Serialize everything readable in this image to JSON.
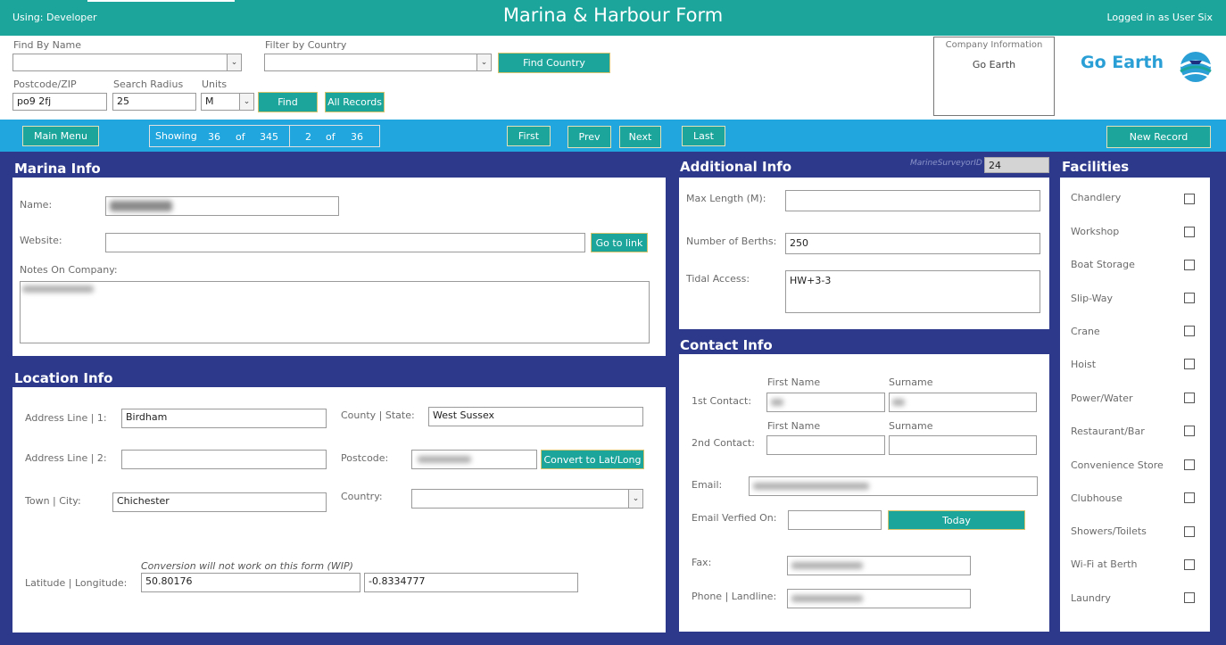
{
  "header": {
    "using": "Using: Developer",
    "title": "Marina & Harbour Form",
    "logged_in": "Logged in as User Six"
  },
  "search": {
    "find_by_name_label": "Find By Name",
    "find_by_name_value": "",
    "filter_country_label": "Filter by Country",
    "filter_country_value": "",
    "find_country_button": "Find Country",
    "postcode_label": "Postcode/ZIP",
    "postcode_value": "po9 2fj",
    "radius_label": "Search Radius",
    "radius_value": "25",
    "units_label": "Units",
    "units_value": "M",
    "find_button": "Find",
    "all_records_button": "All Records"
  },
  "company": {
    "label": "Company Information",
    "value": "Go Earth",
    "logo_text": "Go Earth"
  },
  "nav": {
    "main_menu": "Main Menu",
    "showing_label": "Showing",
    "showing_count": "36",
    "of_label_1": "of",
    "total_count": "345",
    "current_index": "2",
    "of_label_2": "of",
    "page_total": "36",
    "first": "First",
    "prev": "Prev",
    "next": "Next",
    "last": "Last",
    "new_record": "New Record"
  },
  "marina_info": {
    "title": "Marina Info",
    "name_label": "Name:",
    "website_label": "Website:",
    "website_value": "",
    "go_to_link": "Go to link",
    "notes_label": "Notes On Company:"
  },
  "location_info": {
    "title": "Location Info",
    "address1_label": "Address Line | 1:",
    "address1_value": "Birdham",
    "address2_label": "Address Line | 2:",
    "address2_value": "",
    "town_label": "Town | City:",
    "town_value": "Chichester",
    "county_label": "County | State:",
    "county_value": "West Sussex",
    "postcode_label": "Postcode:",
    "convert_button": "Convert to Lat/Long",
    "country_label": "Country:",
    "country_value": "",
    "conversion_note": "Conversion will not work on this form (WIP)",
    "latlong_label": "Latitude | Longitude:",
    "latitude": "50.80176",
    "longitude": "-0.8334777"
  },
  "additional_info": {
    "title": "Additional Info",
    "surveyor_label": "MarineSurveyorID",
    "surveyor_value": "24",
    "max_length_label": "Max Length (M):",
    "max_length_value": "",
    "berths_label": "Number of Berths:",
    "berths_value": "250",
    "tidal_label": "Tidal Access:",
    "tidal_value": "HW+3-3"
  },
  "contact_info": {
    "title": "Contact Info",
    "first_name_label_1": "First Name",
    "surname_label_1": "Surname",
    "contact1_label": "1st Contact:",
    "first_name_label_2": "First Name",
    "surname_label_2": "Surname",
    "contact2_label": "2nd Contact:",
    "email_label": "Email:",
    "email_verified_label": "Email Verfied On:",
    "email_verified_value": "",
    "today_button": "Today",
    "fax_label": "Fax:",
    "phone_label": "Phone | Landline:"
  },
  "facilities": {
    "title": "Facilities",
    "items": [
      {
        "label": "Chandlery",
        "checked": false
      },
      {
        "label": "Workshop",
        "checked": false
      },
      {
        "label": "Boat Storage",
        "checked": false
      },
      {
        "label": "Slip-Way",
        "checked": false
      },
      {
        "label": "Crane",
        "checked": false
      },
      {
        "label": "Hoist",
        "checked": false
      },
      {
        "label": "Power/Water",
        "checked": false
      },
      {
        "label": "Restaurant/Bar",
        "checked": false
      },
      {
        "label": "Convenience Store",
        "checked": false
      },
      {
        "label": "Clubhouse",
        "checked": false
      },
      {
        "label": "Showers/Toilets",
        "checked": false
      },
      {
        "label": "Wi-Fi at Berth",
        "checked": false
      },
      {
        "label": "Laundry",
        "checked": false
      }
    ]
  },
  "colors": {
    "teal": "#1ba59b",
    "sky": "#21a6dd",
    "navy": "#2d3a8c"
  }
}
